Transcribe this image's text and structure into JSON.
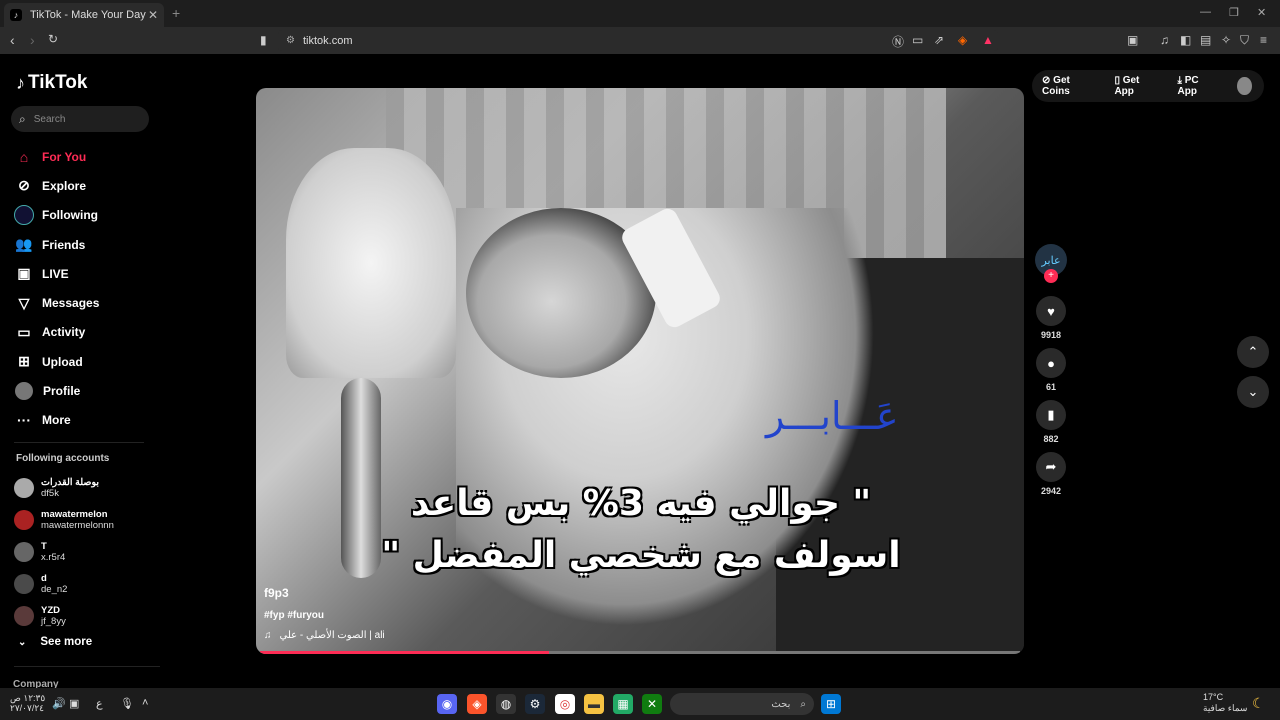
{
  "browser": {
    "tab_title": "TikTok - Make Your Day",
    "tab_close": "✕",
    "new_tab": "+",
    "url": "tiktok.com"
  },
  "sidebar": {
    "logo_text": "TikTok",
    "search_placeholder": "Search",
    "nav": [
      {
        "label": "For You",
        "icon": "home-icon",
        "active": true
      },
      {
        "label": "Explore",
        "icon": "compass-icon"
      },
      {
        "label": "Following",
        "icon": "following-icon"
      },
      {
        "label": "Friends",
        "icon": "friends-icon"
      },
      {
        "label": "LIVE",
        "icon": "live-icon"
      },
      {
        "label": "Messages",
        "icon": "messages-icon"
      },
      {
        "label": "Activity",
        "icon": "activity-icon"
      },
      {
        "label": "Upload",
        "icon": "upload-icon"
      },
      {
        "label": "Profile",
        "icon": "profile-icon"
      },
      {
        "label": "More",
        "icon": "more-icon"
      }
    ],
    "following_title": "Following accounts",
    "following": [
      {
        "name": "بوصلة القدرات",
        "handle": "df5k"
      },
      {
        "name": "mawatermelon",
        "handle": "mawatermelonnn"
      },
      {
        "name": "T",
        "handle": "x.r5r4"
      },
      {
        "name": "d",
        "handle": "de_n2"
      },
      {
        "name": "YZD",
        "handle": "jf_8yy"
      }
    ],
    "see_more": "See more",
    "company": "Company"
  },
  "video": {
    "overlay_title": "عَـــابـــر",
    "caption_line1": "\" جوالي فيه 3% بس قاعد",
    "caption_line2": "اسولف مع شخصي المفضل \"",
    "author": "f9p3",
    "hashtags": "#fyp #furyou",
    "sound": "الصوت الأصلي - علي | ali",
    "progress_fraction": 0.38
  },
  "actions": {
    "avatar_text": "عابر",
    "likes": "9918",
    "comments": "61",
    "saves": "882",
    "shares": "2942"
  },
  "header": {
    "get_coins": "Get Coins",
    "get_app": "Get App",
    "pc_app": "PC App"
  },
  "taskbar": {
    "time": "١٢:٣٥ ص",
    "date": "٢٧/٠٧/٢٤",
    "lang": "ع",
    "search_placeholder": "بحث",
    "temperature": "17°C",
    "weather": "سماء صافية"
  }
}
